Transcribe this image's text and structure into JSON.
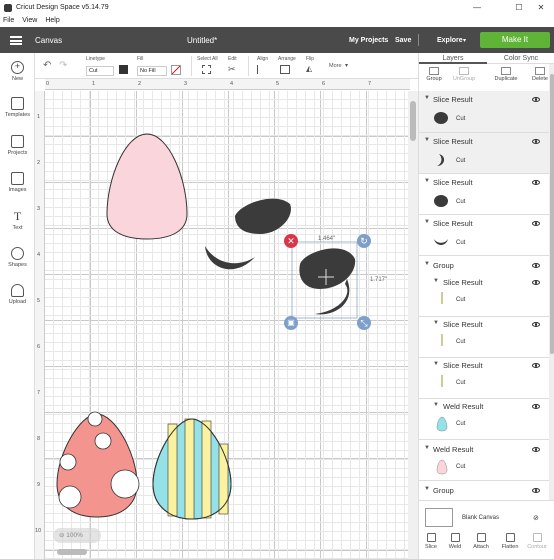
{
  "window": {
    "title": "Cricut Design Space  v5.14.79",
    "controls": [
      "—",
      "☐",
      "✕"
    ]
  },
  "menu": [
    "File",
    "View",
    "Help"
  ],
  "header": {
    "section": "Canvas",
    "project_title": "Untitled*",
    "my_projects": "My Projects",
    "save": "Save",
    "machine": "Explore",
    "make_it": "Make It"
  },
  "toolbar": {
    "linetype_label": "Linetype",
    "linetype_value": "Cut",
    "fill_label": "Fill",
    "fill_value": "No Fill",
    "select_all": "Select All",
    "edit": "Edit",
    "align": "Align",
    "arrange": "Arrange",
    "flip": "Flip",
    "more": "More"
  },
  "leftnav": [
    {
      "label": "New"
    },
    {
      "label": "Templates"
    },
    {
      "label": "Projects"
    },
    {
      "label": "Images"
    },
    {
      "label": "Text"
    },
    {
      "label": "Shapes"
    },
    {
      "label": "Upload"
    }
  ],
  "canvas": {
    "ruler_top": [
      "0",
      "1",
      "2",
      "3",
      "4",
      "5",
      "6",
      "7"
    ],
    "ruler_left": [
      "1",
      "2",
      "3",
      "4",
      "5",
      "6",
      "7",
      "8",
      "9",
      "10",
      "11"
    ],
    "width_readout": "1.464\"",
    "height_readout": "1.717\"",
    "zoom": "100%"
  },
  "colors": {
    "pink": "#fbd5dc",
    "dark": "#3b3b3b",
    "salmon": "#f4948e",
    "cyan": "#95e1e8",
    "yellow": "#fbf2a0",
    "green": "#5fb336",
    "handle_blue": "#7ea0c8",
    "handle_red": "#d9364a"
  },
  "panel": {
    "tabs": [
      "Layers",
      "Color Sync"
    ],
    "actions": [
      "Group",
      "UnGroup",
      "Duplicate",
      "Delete"
    ],
    "layers": [
      {
        "title": "Slice Result",
        "op": "Cut"
      },
      {
        "title": "Slice Result",
        "op": "Cut"
      },
      {
        "title": "Slice Result",
        "op": "Cut"
      },
      {
        "title": "Slice Result",
        "op": "Cut"
      },
      {
        "title": "Group",
        "op": ""
      },
      {
        "title": "Slice Result",
        "op": "Cut"
      },
      {
        "title": "Slice Result",
        "op": "Cut"
      },
      {
        "title": "Slice Result",
        "op": "Cut"
      },
      {
        "title": "Weld Result",
        "op": "Cut"
      },
      {
        "title": "Weld Result",
        "op": "Cut"
      },
      {
        "title": "Group",
        "op": ""
      }
    ],
    "blank_canvas": "Blank Canvas",
    "bottom_actions": [
      "Slice",
      "Weld",
      "Attach",
      "Flatten",
      "Contour"
    ]
  }
}
